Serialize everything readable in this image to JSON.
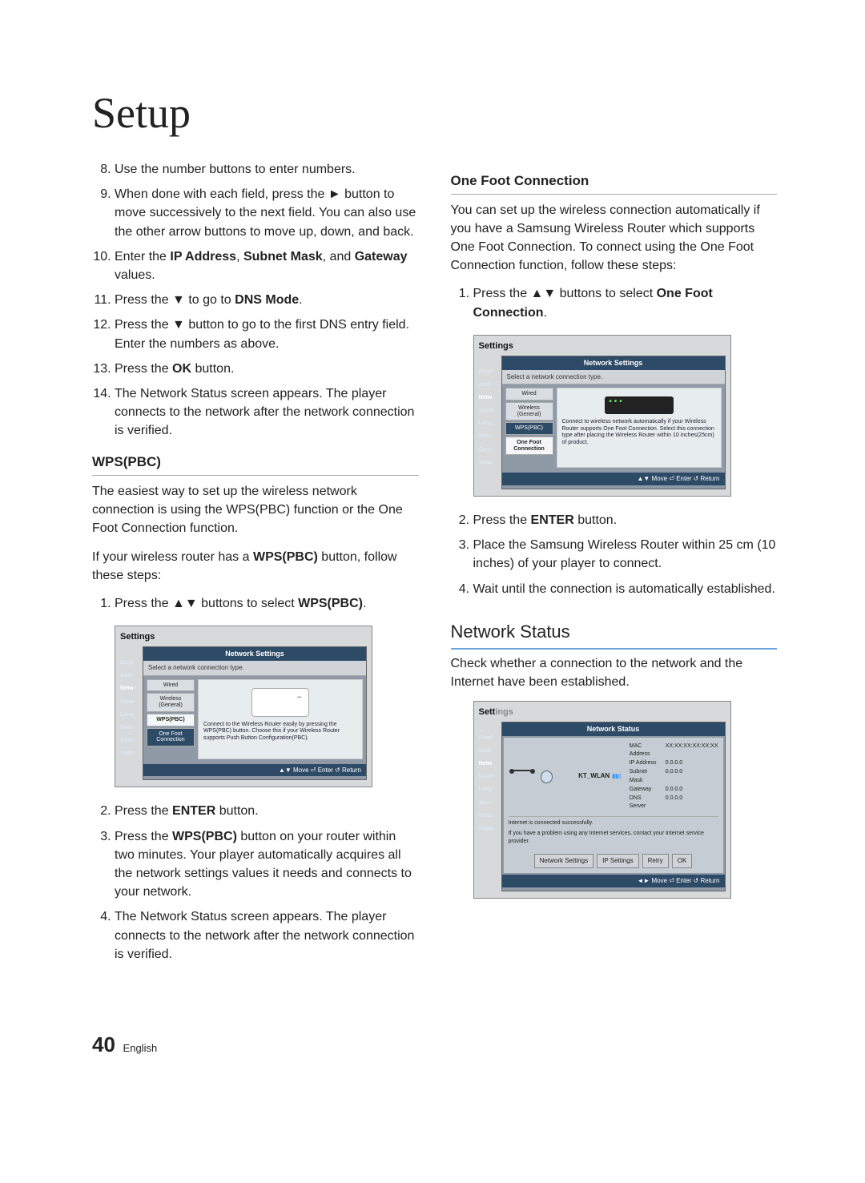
{
  "title": "Setup",
  "col1": {
    "steps_start": 8,
    "steps": [
      "Use the number buttons to enter numbers.",
      "When done with each field, press the ► button to move successively to the next field. You can also use the other arrow buttons to move up, down, and back.",
      "Enter the IP Address, Subnet Mask, and Gateway values.",
      "Press the ▼ to go to DNS Mode.",
      "Press the ▼ button to go to the first DNS entry field. Enter the numbers as above.",
      "Press the OK button.",
      "The Network Status screen appears. The player connects to the network after the network connection is verified."
    ],
    "wps_head": "WPS(PBC)",
    "wps_p1": "The easiest way to set up the wireless network connection is using the WPS(PBC) function or the One Foot Connection function.",
    "wps_p2_pre": "If your wireless router has a ",
    "wps_p2_bold": "WPS(PBC)",
    "wps_p2_post": " button, follow these steps:",
    "wps_steps": [
      "Press the ▲▼ buttons to select WPS(PBC).",
      "Press the ENTER button.",
      "Press the WPS(PBC) button on your router within two minutes. Your player automatically acquires all the network settings values it needs and connects to your network.",
      "The Network Status screen appears. The player connects to the network after the network connection is verified."
    ]
  },
  "col2": {
    "ofc_head": "One Foot Connection",
    "ofc_intro": "You can set up the wireless connection automatically if you have a Samsung Wireless Router which supports One Foot Connection. To connect using the One Foot Connection function, follow these steps:",
    "ofc_steps_a": [
      "Press the ▲▼ buttons to select One Foot Connection."
    ],
    "ofc_steps_b": [
      "Press the ENTER button.",
      "Place the Samsung Wireless Router within 25 cm (10 inches) of your player to connect.",
      "Wait until the connection is automatically established."
    ],
    "ns_head": "Network Status",
    "ns_intro": "Check whether a connection to the network and the Internet have been established."
  },
  "shot_common": {
    "settings_label": "Settings",
    "panel_title": "Network Settings",
    "sub_bar": "Select a network connection type.",
    "side": [
      "Wired",
      "Wireless (General)",
      "WPS(PBC)",
      "One Foot Connection"
    ],
    "cats": [
      "Displ",
      "Audi",
      "Netw",
      "Syste",
      "Lang",
      "Secu",
      "Gene",
      "Supp"
    ],
    "footer": "▲▼ Move   ⏎ Enter   ↺ Return"
  },
  "shot_wps_desc": "Connect to the Wireless Router easily by pressing the WPS(PBC) button. Choose this if your Wireless Router supports Push Button Configuration(PBC).",
  "shot_ofc_desc": "Connect to wireless network automatically if your Wireless Router supports One Foot Connection. Select this connection type after placing the Wireless Router within 10 inches(25cm) of product.",
  "shot_ns": {
    "panel_title": "Network Status",
    "ssid": "KT_WLAN",
    "fields": [
      [
        "MAC Address",
        "XX:XX:XX:XX:XX:XX"
      ],
      [
        "IP Address",
        "0.0.0.0"
      ],
      [
        "Subnet Mask",
        "0.0.0.0"
      ],
      [
        "Gateway",
        "0.0.0.0"
      ],
      [
        "DNS Server",
        "0.0.0.0"
      ]
    ],
    "msg1": "Internet is connected successfully.",
    "msg2": "If you have a problem using any Internet services, contact your Internet service provider.",
    "buttons": [
      "Network Settings",
      "IP Settings",
      "Retry",
      "OK"
    ],
    "footer": "◄► Move   ⏎ Enter   ↺ Return"
  },
  "footer": {
    "page_num": "40",
    "lang": "English"
  }
}
